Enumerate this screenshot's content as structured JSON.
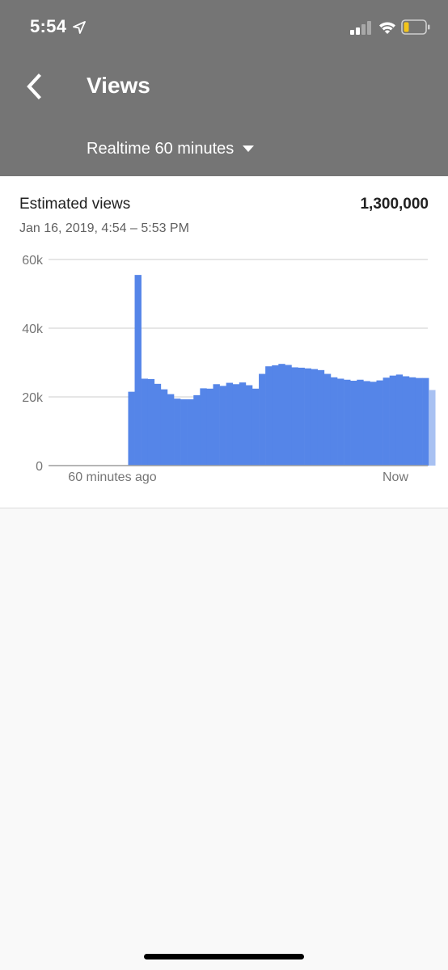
{
  "status_bar": {
    "time": "5:54"
  },
  "header": {
    "title": "Views",
    "range_label": "Realtime 60 minutes",
    "background": "#757575"
  },
  "metric": {
    "label": "Estimated views",
    "value": "1,300,000",
    "date_range": "Jan 16, 2019, 4:54 – 5:53 PM"
  },
  "icons": {
    "back": "chevron-left-icon",
    "location": "location-arrow-icon",
    "signal": "cellular-signal-icon",
    "wifi": "wifi-icon",
    "battery": "battery-low-icon",
    "dropdown": "caret-down-icon"
  },
  "colors": {
    "bar": "#5585e8",
    "bar_partial": "#a8c1f2",
    "battery_level": "#f3c51a"
  },
  "chart_data": {
    "type": "bar",
    "x_tick_labels": [
      "60 minutes ago",
      "Now"
    ],
    "y_tick_labels": [
      "0",
      "20k",
      "40k",
      "60k"
    ],
    "ylim": [
      0,
      60000
    ],
    "grid": true,
    "values": [
      0,
      0,
      0,
      0,
      0,
      0,
      0,
      0,
      0,
      0,
      0,
      0,
      21500,
      55500,
      25300,
      25200,
      23800,
      22200,
      20800,
      19500,
      19300,
      19300,
      20500,
      22500,
      22400,
      23700,
      23200,
      24100,
      23700,
      24200,
      23400,
      22400,
      26700,
      28900,
      29200,
      29600,
      29300,
      28600,
      28500,
      28300,
      28100,
      27800,
      26700,
      25700,
      25300,
      25000,
      24700,
      25000,
      24600,
      24400,
      24800,
      25600,
      26200,
      26500,
      26000,
      25700,
      25500,
      25500,
      22000
    ],
    "last_value_partial": true
  }
}
